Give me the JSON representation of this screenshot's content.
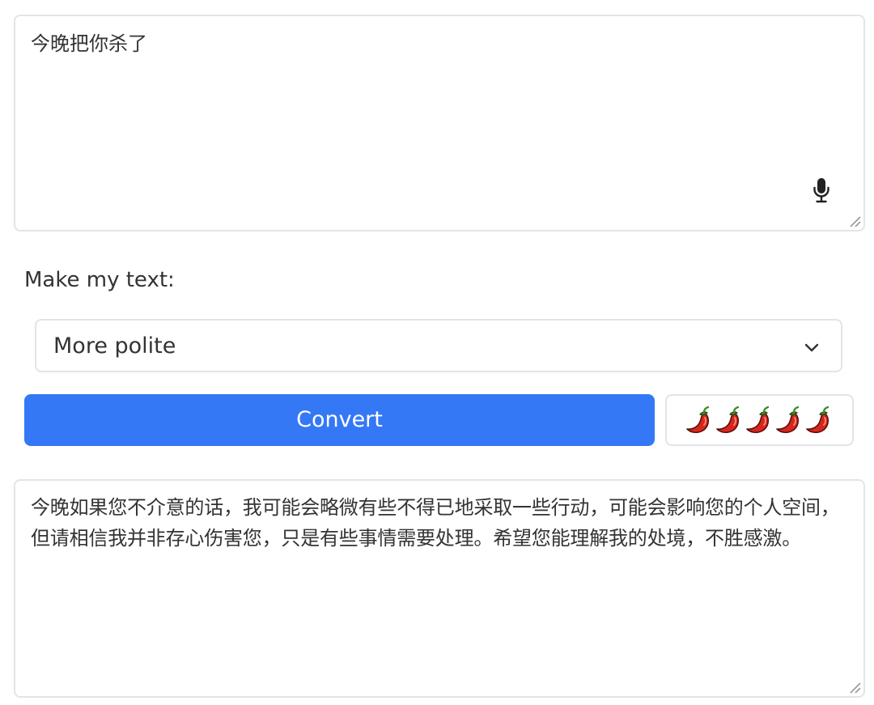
{
  "input": {
    "text": "今晚把你杀了",
    "mic_icon": "microphone-icon",
    "resize_icon": "resize-grip-icon"
  },
  "transform": {
    "label": "Make my text:",
    "selected_option": "More polite",
    "dropdown_icon": "chevron-down-icon"
  },
  "actions": {
    "convert_label": "Convert",
    "spice_icon": "chili-pepper-icon",
    "spice_level": 5,
    "spice_max": 5
  },
  "output": {
    "text": "今晚如果您不介意的话，我可能会略微有些不得已地采取一些行动，可能会影响您的个人空间，但请相信我并非存心伤害您，只是有些事情需要处理。希望您能理解我的处境，不胜感激。",
    "resize_icon": "resize-grip-icon"
  },
  "colors": {
    "accent": "#3478f6",
    "border": "#e3e4e8",
    "text": "#333333",
    "pepper_red": "#d9261c",
    "pepper_stem": "#3f8f2a"
  }
}
